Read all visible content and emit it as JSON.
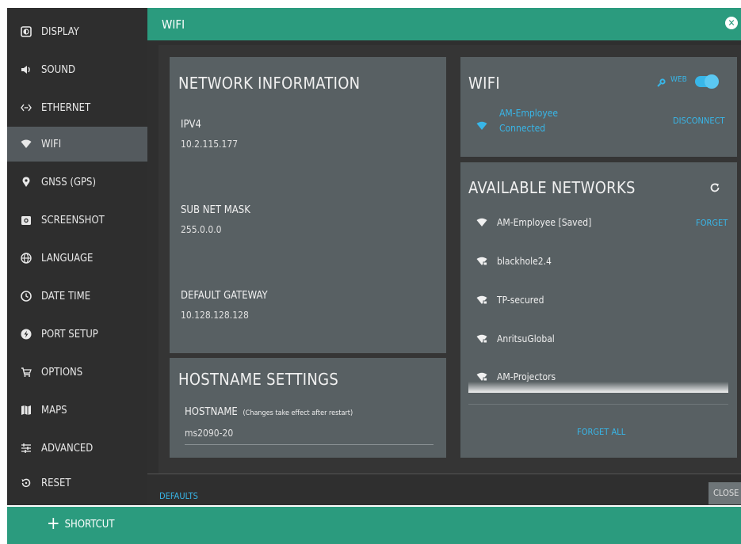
{
  "sidebar": {
    "items": [
      {
        "label": "DISPLAY",
        "icon": "display-icon"
      },
      {
        "label": "SOUND",
        "icon": "speaker-icon"
      },
      {
        "label": "ETHERNET",
        "icon": "ethernet-icon"
      },
      {
        "label": "WIFI",
        "icon": "wifi-icon",
        "active": true
      },
      {
        "label": "GNSS (GPS)",
        "icon": "location-pin-icon"
      },
      {
        "label": "SCREENSHOT",
        "icon": "camera-icon"
      },
      {
        "label": "LANGUAGE",
        "icon": "globe-icon"
      },
      {
        "label": "DATE TIME",
        "icon": "clock-icon"
      },
      {
        "label": "PORT SETUP",
        "icon": "power-port-icon"
      },
      {
        "label": "OPTIONS",
        "icon": "cart-icon"
      },
      {
        "label": "MAPS",
        "icon": "map-icon"
      },
      {
        "label": "ADVANCED",
        "icon": "sliders-icon"
      },
      {
        "label": "RESET",
        "icon": "reset-icon"
      }
    ]
  },
  "header": {
    "title": "WIFI"
  },
  "network_info": {
    "title": "NETWORK INFORMATION",
    "ipv4_label": "IPV4",
    "ipv4_value": "10.2.115.177",
    "subnet_label": "SUB NET MASK",
    "subnet_value": "255.0.0.0",
    "gateway_label": "DEFAULT GATEWAY",
    "gateway_value": "10.128.128.128"
  },
  "hostname": {
    "title": "HOSTNAME SETTINGS",
    "label": "HOSTNAME",
    "note": "(Changes take effect after restart)",
    "value": "ms2090-20"
  },
  "wifi_status": {
    "title": "WIFI",
    "web_label": "WEB",
    "web_enabled": true,
    "ssid": "AM-Employee",
    "state": "Connected",
    "disconnect_label": "DISCONNECT"
  },
  "available": {
    "title": "AVAILABLE NETWORKS",
    "networks": [
      {
        "name": "AM-Employee [Saved]",
        "secured": false,
        "action": "FORGET"
      },
      {
        "name": "blackhole2.4",
        "secured": true
      },
      {
        "name": "TP-secured",
        "secured": true
      },
      {
        "name": "AnritsuGlobal",
        "secured": true
      },
      {
        "name": "AM-Projectors",
        "secured": true
      }
    ],
    "forget_all_label": "FORGET ALL"
  },
  "footer": {
    "defaults_label": "DEFAULTS",
    "close_label": "CLOSE"
  },
  "shortcut": {
    "label": "SHORTCUT"
  },
  "colors": {
    "accent": "#2b9b7e",
    "link": "#38b6e8",
    "panel": "#586063",
    "sidebar": "#2e2e2e"
  }
}
